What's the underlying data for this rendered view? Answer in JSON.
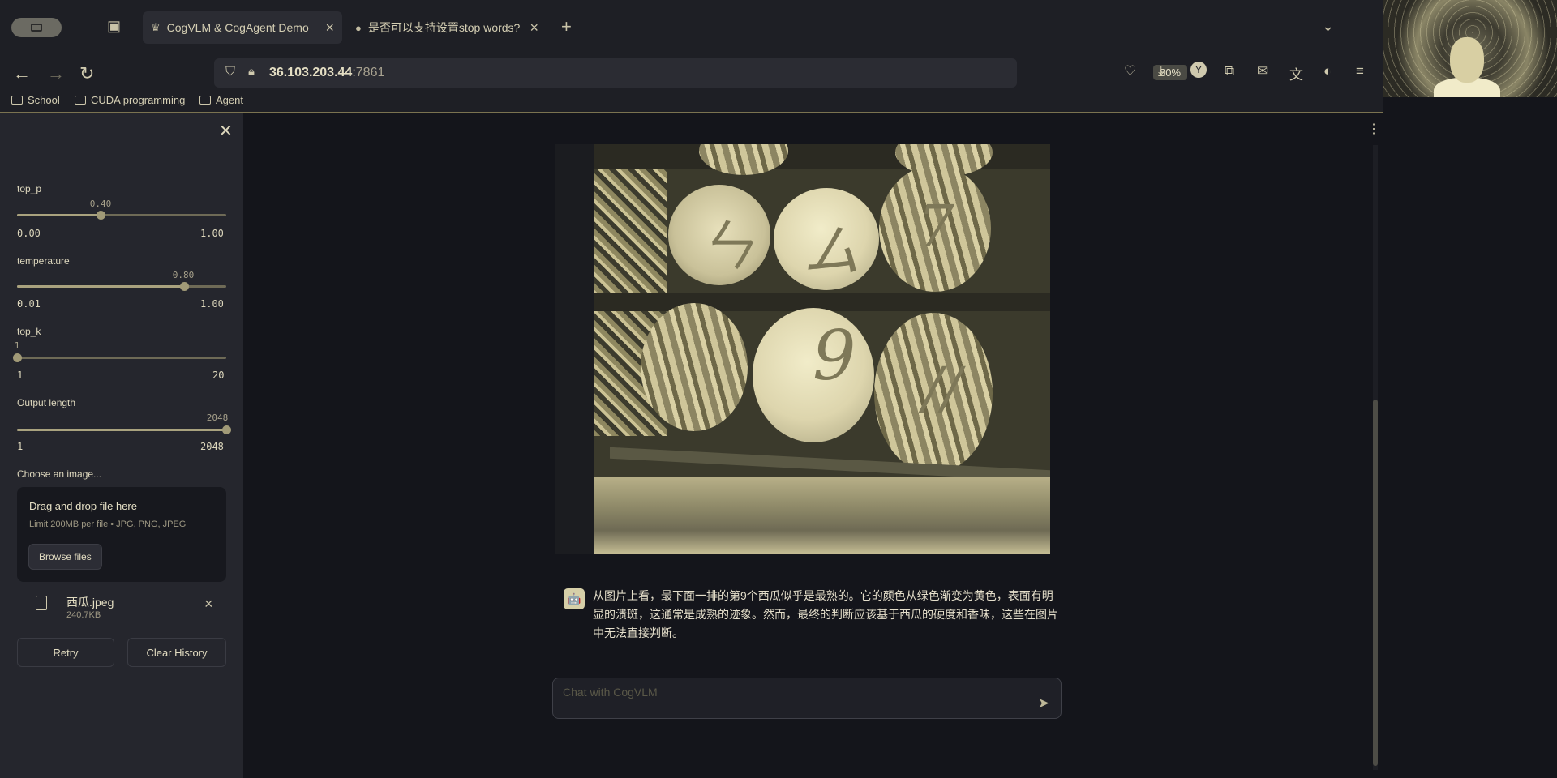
{
  "browser": {
    "tabs": [
      {
        "label": "CogVLM & CogAgent Demo",
        "active": true
      },
      {
        "label": "是否可以支持设置stop words?",
        "active": false
      }
    ],
    "url": {
      "host": "36.103.203.44",
      "port": ":7861"
    },
    "zoom": "80%",
    "bookmarks": [
      "School",
      "CUDA programming",
      "Agent"
    ]
  },
  "sidebar": {
    "sliders": [
      {
        "label": "top_p",
        "value": "0.40",
        "min": "0.00",
        "max": "1.00",
        "fraction": 0.4
      },
      {
        "label": "temperature",
        "value": "0.80",
        "min": "0.01",
        "max": "1.00",
        "fraction": 0.798
      },
      {
        "label": "top_k",
        "value": "1",
        "min": "1",
        "max": "20",
        "fraction": 0.0
      },
      {
        "label": "Output length",
        "value": "2048",
        "min": "1",
        "max": "2048",
        "fraction": 1.0
      }
    ],
    "uploader": {
      "label": "Choose an image...",
      "title": "Drag and drop file here",
      "limit": "Limit 200MB per file • JPG, PNG, JPEG",
      "browse_label": "Browse files"
    },
    "file": {
      "name": "西瓜.jpeg",
      "size": "240.7KB"
    },
    "buttons": {
      "retry": "Retry",
      "clear": "Clear History"
    }
  },
  "chat": {
    "reply": "从图片上看，最下面一排的第9个西瓜似乎是最熟的。它的颜色从绿色渐变为黄色，表面有明显的溃斑，这通常是成熟的迹象。然而，最终的判断应该基于西瓜的硬度和香味，这些在图片中无法直接判断。",
    "input_placeholder": "Chat with CogVLM"
  },
  "icons": {
    "close": "✕",
    "send": "➤",
    "kebab": "⋮",
    "bot": "🤖"
  }
}
